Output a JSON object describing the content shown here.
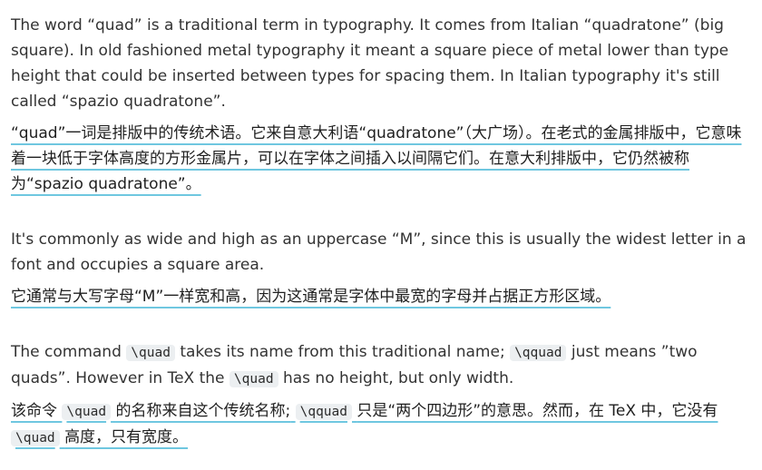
{
  "block1": {
    "en": "The word “quad” is a traditional term in typography. It comes from Italian “quadratone” (big square). In old fashioned metal typography it meant a square piece of metal lower than type height that could be inserted between types for spacing them. In Italian typography it's still called “spazio quadratone”.",
    "zh": "“quad”一词是排版中的传统术语。它来自意大利语“quadratone”（大广场）。在老式的金属排版中，它意味着一块低于字体高度的方形金属片，可以在字体之间插入以间隔它们。在意大利排版中，它仍然被称为“spazio quadratone”。"
  },
  "block2": {
    "en": "It's commonly as wide and high as an uppercase “M”, since this is usually the widest letter in a font and occupies a square area.",
    "zh": "它通常与大写字母“M”一样宽和高，因为这通常是字体中最宽的字母并占据正方形区域。"
  },
  "block3": {
    "en_1": "The command",
    "code_quad": "\\quad",
    "en_2": "takes its name from this traditional name;",
    "code_qquad": "\\qquad",
    "en_3": "just means ”two quads”. However in TeX the",
    "en_4": "has no height, but only width.",
    "zh_1": "该命令",
    "zh_2": "的名称来自这个传统名称;",
    "zh_3": "只是“两个四边形”的意思。然而，在 TeX 中，它没有",
    "zh_4": "高度，只有宽度。"
  },
  "colors": {
    "underline": "#6fc7e0",
    "code_bg": "#eceff1"
  }
}
